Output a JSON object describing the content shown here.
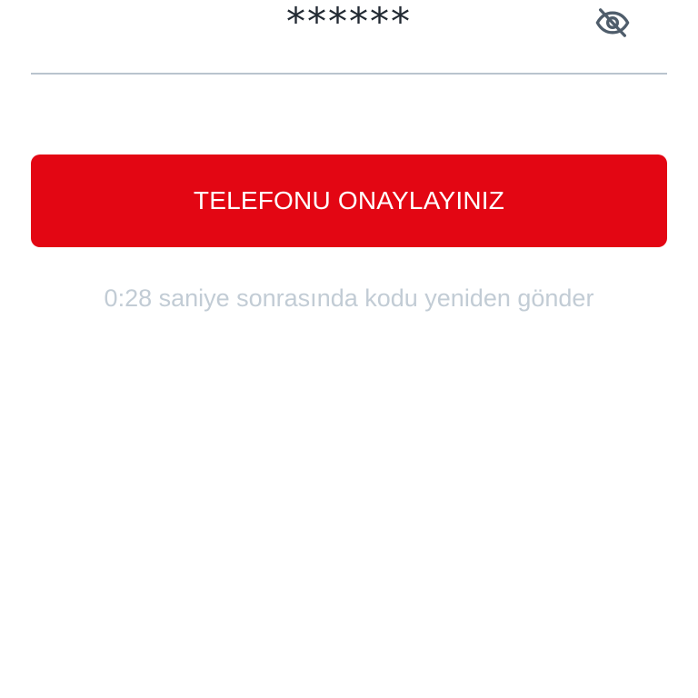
{
  "code_field": {
    "value": "******",
    "toggle_icon": "eye-off-icon"
  },
  "confirm_button": {
    "label": "TELEFONU ONAYLAYINIZ"
  },
  "resend": {
    "text": "0:28 saniye sonrasında kodu yeniden gönder"
  },
  "colors": {
    "primary": "#e30613",
    "underline": "#b9c4ce",
    "muted_text": "#c2ccd5",
    "icon": "#4f5d6b",
    "text": "#222a33"
  }
}
